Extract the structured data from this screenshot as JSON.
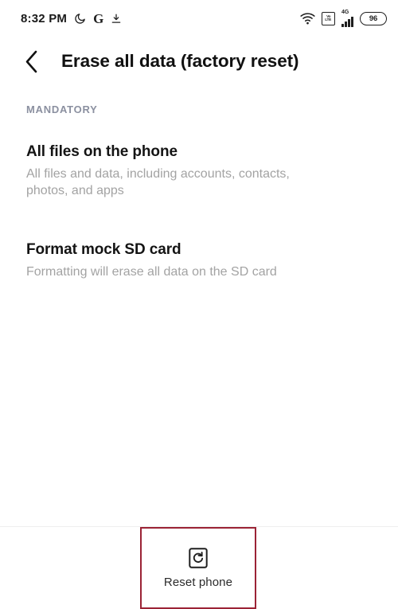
{
  "status_bar": {
    "time": "8:32 PM",
    "dnd_icon": "moon-icon",
    "google_icon_letter": "G",
    "download_icon": "download-icon",
    "wifi_icon": "wifi-icon",
    "volte_line1": "Vo",
    "volte_line2": "LTE",
    "network_type": "4G",
    "battery_level": "96"
  },
  "app_bar": {
    "back_label": "Back",
    "title": "Erase all data (factory reset)"
  },
  "content": {
    "section_label": "MANDATORY",
    "items": [
      {
        "title": "All files on the phone",
        "subtitle": "All files and data, including accounts, contacts, photos, and apps"
      },
      {
        "title": "Format mock SD card",
        "subtitle": "Formatting will erase all data on the SD card"
      }
    ]
  },
  "bottom_action": {
    "icon": "reset-icon",
    "label": "Reset phone"
  },
  "colors": {
    "highlight_border": "#9b2335",
    "section_label": "#8b90a0",
    "subtitle": "#a3a3a3",
    "title": "#111111",
    "divider": "#eeeeee"
  }
}
